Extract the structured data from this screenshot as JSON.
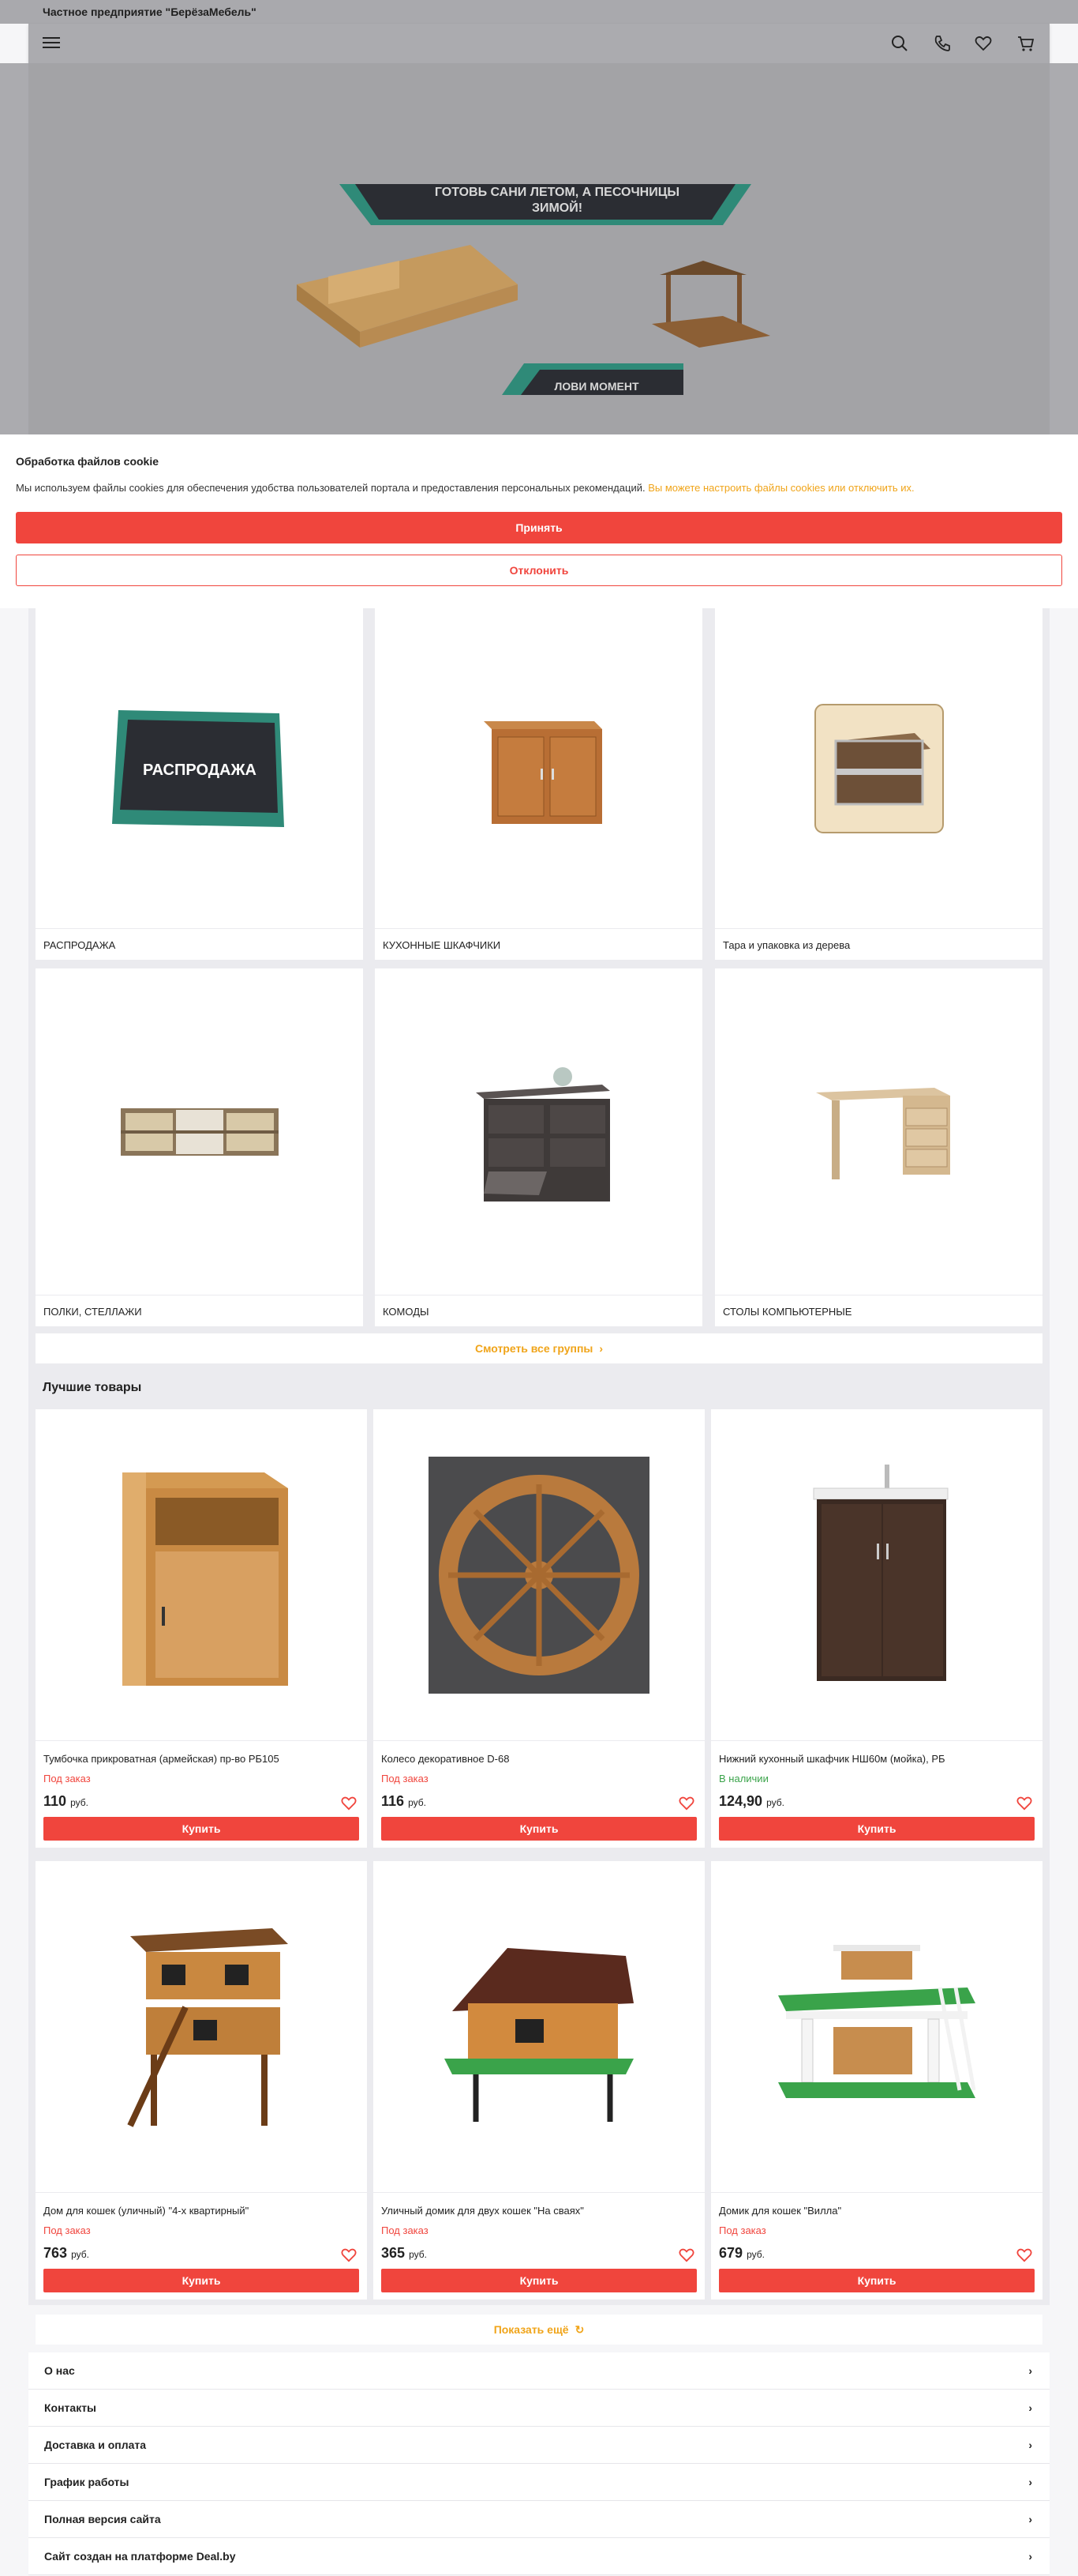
{
  "company_name": "Частное предприятие \"БерёзаМебель\"",
  "hero": {
    "banner_line1": "ГОТОВЬ САНИ ЛЕТОМ, А ПЕСОЧНИЦЫ",
    "banner_line2": "ЗИМОЙ!",
    "banner_cta": "ЛОВИ МОМЕНТ"
  },
  "cookie": {
    "title": "Обработка файлов cookie",
    "text": "Мы используем файлы cookies для обеспечения удобства пользователей портала и предоставления персональных рекомендаций.",
    "link": "Вы можете настроить файлы cookies или отключить их.",
    "accept": "Принять",
    "decline": "Отклонить"
  },
  "groups": [
    {
      "label": "РАСПРОДАЖА",
      "badge": "РАСПРОДАЖА"
    },
    {
      "label": "КУХОННЫЕ ШКАФЧИКИ"
    },
    {
      "label": "Тара и упаковка из дерева"
    },
    {
      "label": "ПОЛКИ, СТЕЛЛАЖИ"
    },
    {
      "label": "КОМОДЫ"
    },
    {
      "label": "СТОЛЫ КОМПЬЮТЕРНЫЕ"
    }
  ],
  "see_all_groups": "Смотреть все группы",
  "best_title": "Лучшие товары",
  "products": [
    {
      "name": "Тумбочка прикроватная (армейская) пр-во РБ105",
      "status": "Под заказ",
      "price": "110",
      "currency": "руб.",
      "buy": "Купить"
    },
    {
      "name": "Колесо декоративное D-68",
      "status": "Под заказ",
      "price": "116",
      "currency": "руб.",
      "buy": "Купить"
    },
    {
      "name": "Нижний кухонный шкафчик НШ60м (мойка), РБ",
      "status": "В наличии",
      "price": "124,90",
      "currency": "руб.",
      "buy": "Купить"
    },
    {
      "name": "Дом для кошек (уличный) \"4-х квартирный\"",
      "status": "Под заказ",
      "price": "763",
      "currency": "руб.",
      "buy": "Купить"
    },
    {
      "name": "Уличный домик для двух кошек \"На сваях\"",
      "status": "Под заказ",
      "price": "365",
      "currency": "руб.",
      "buy": "Купить"
    },
    {
      "name": "Домик для кошек \"Вилла\"",
      "status": "Под заказ",
      "price": "679",
      "currency": "руб.",
      "buy": "Купить"
    }
  ],
  "show_more": "Показать ещё",
  "footer_links": [
    "О нас",
    "Контакты",
    "Доставка и оплата",
    "График работы",
    "Полная версия сайта",
    "Сайт создан на платформе Deal.by"
  ],
  "colors": {
    "accent": "#f0453d",
    "link": "#f0a419",
    "in_stock": "#3aa34a"
  }
}
